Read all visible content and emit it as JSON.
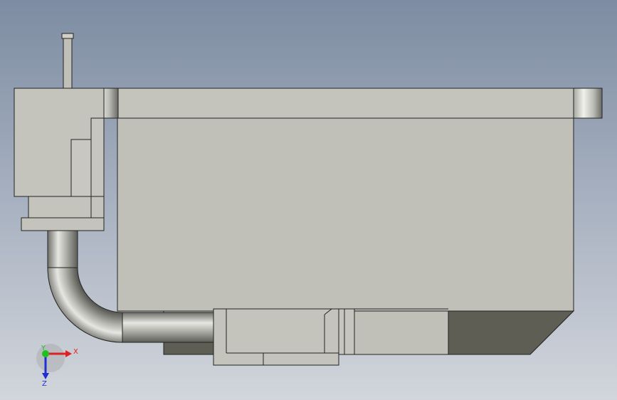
{
  "colors": {
    "background_top": "#7d8ca2",
    "background_bottom": "#d2d6dc",
    "body_face": "#c0c0b8",
    "dark_face": "#5e5e55",
    "edge": "#222222",
    "x_axis": "#e02020",
    "y_axis": "#20c020",
    "z_axis": "#2030d0"
  },
  "triad": {
    "x_label": "X",
    "y_label": "Y",
    "z_label": "Z"
  }
}
